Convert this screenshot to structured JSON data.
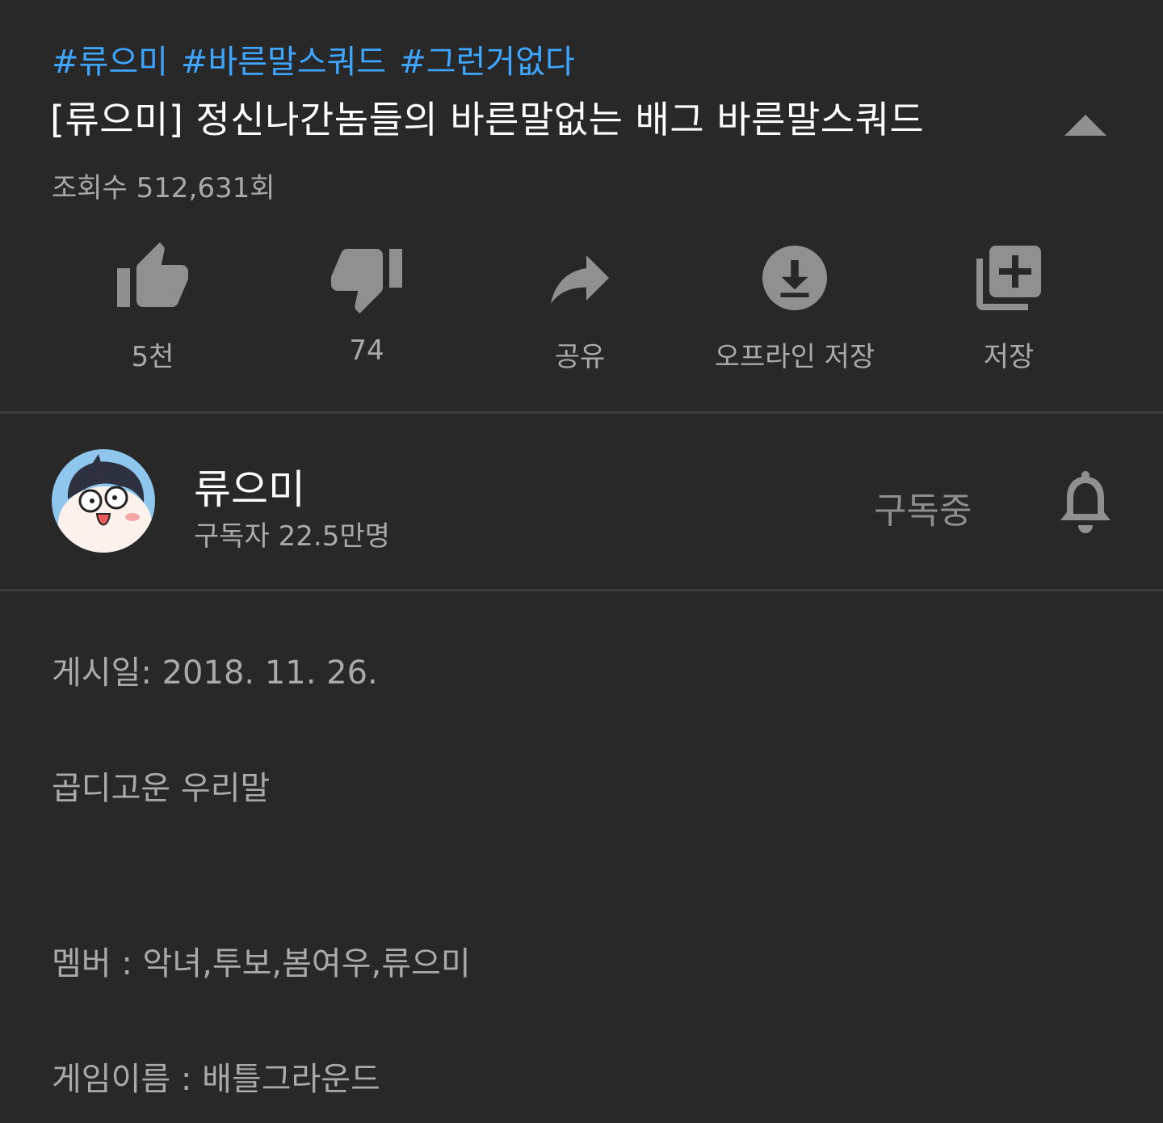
{
  "hashtags": [
    "#류으미",
    "#바른말스쿼드",
    "#그런거없다"
  ],
  "title": "[류으미] 정신나간놈들의 바른말없는 배그 바른말스쿼드",
  "views": "조회수 512,631회",
  "actions": {
    "like": {
      "label": "5천",
      "icon": "thumbs-up-icon"
    },
    "dislike": {
      "label": "74",
      "icon": "thumbs-down-icon"
    },
    "share": {
      "label": "공유",
      "icon": "share-icon"
    },
    "download": {
      "label": "오프라인 저장",
      "icon": "download-icon"
    },
    "save": {
      "label": "저장",
      "icon": "playlist-add-icon"
    }
  },
  "channel": {
    "name": "류으미",
    "subscribers": "구독자 22.5만명",
    "subscribe_status": "구독중"
  },
  "description": {
    "published": "게시일: 2018. 11. 26.",
    "line1": "곱디고운 우리말",
    "members": "멤버 : 악녀,투보,봄여우,류으미",
    "game": "게임이름 : 배틀그라운드"
  },
  "colors": {
    "background": "#282828",
    "hashtag": "#3ea6ff",
    "icon": "#909090",
    "secondary_text": "#aaaaaa"
  }
}
